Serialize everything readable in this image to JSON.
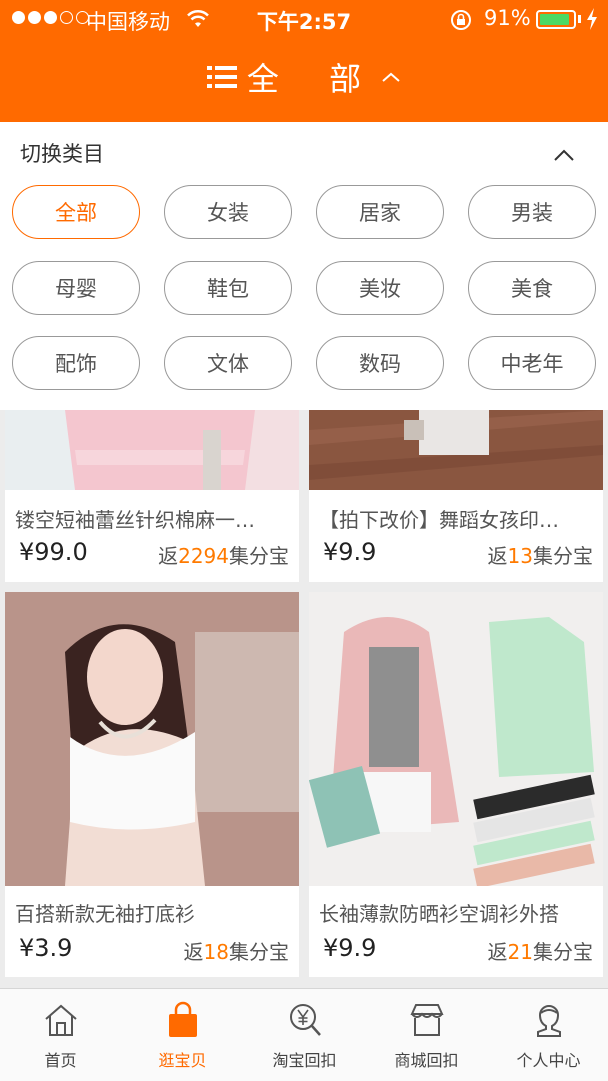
{
  "status_bar": {
    "carrier": "中国移动",
    "time": "下午2:57",
    "battery": "91%",
    "battery_level": 0.91,
    "signal_bars": 3
  },
  "header": {
    "title": "全 部",
    "icon": "list-icon",
    "toggle_icon": "chevron-up-icon"
  },
  "category_panel": {
    "title": "切换类目",
    "collapse_icon": "chevron-up-icon",
    "categories": [
      "全部",
      "女装",
      "居家",
      "男装",
      "母婴",
      "鞋包",
      "美妆",
      "美食",
      "配饰",
      "文体",
      "数码",
      "中老年"
    ],
    "selected": "全部"
  },
  "products": [
    {
      "title": "镂空短袖蕾丝针织棉麻一…",
      "price": "¥99.0",
      "rebate_prefix": "返",
      "rebate_points": "2294",
      "rebate_suffix": "集分宝"
    },
    {
      "title": "【拍下改价】舞蹈女孩印…",
      "price": "¥9.9",
      "rebate_prefix": "返",
      "rebate_points": "13",
      "rebate_suffix": "集分宝"
    },
    {
      "title": "百搭新款无袖打底衫",
      "price": "¥3.9",
      "rebate_prefix": "返",
      "rebate_points": "18",
      "rebate_suffix": "集分宝"
    },
    {
      "title": "长袖薄款防晒衫空调衫外搭",
      "price": "¥9.9",
      "rebate_prefix": "返",
      "rebate_points": "21",
      "rebate_suffix": "集分宝"
    }
  ],
  "tab_bar": {
    "tabs": [
      {
        "label": "首页",
        "icon": "home-icon"
      },
      {
        "label": "逛宝贝",
        "icon": "shopping-bag-icon"
      },
      {
        "label": "淘宝回扣",
        "icon": "yen-search-icon"
      },
      {
        "label": "商城回扣",
        "icon": "store-icon"
      },
      {
        "label": "个人中心",
        "icon": "user-icon"
      }
    ],
    "active": "逛宝贝"
  },
  "colors": {
    "accent": "#ff6a00",
    "rebate_number": "#ff7a00",
    "battery": "#4cd964"
  }
}
